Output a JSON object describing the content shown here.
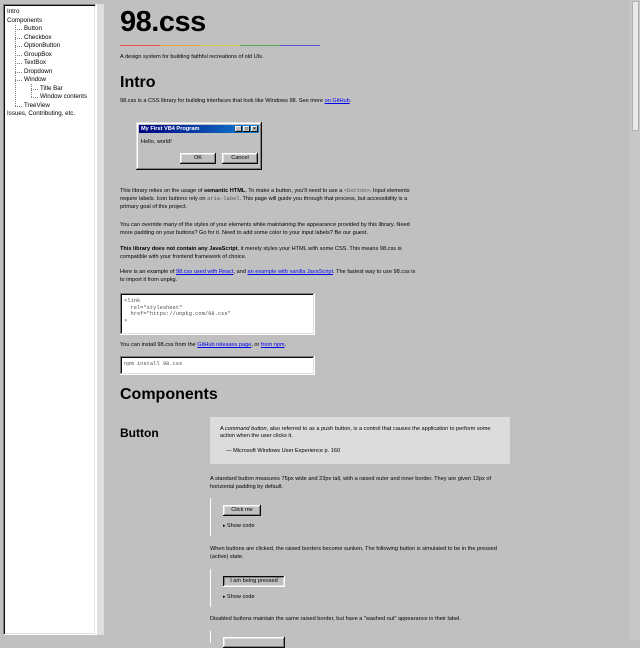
{
  "sidebar": {
    "items": [
      {
        "label": "Intro",
        "level": 0
      },
      {
        "label": "Components",
        "level": 0
      },
      {
        "label": "Button",
        "level": 1
      },
      {
        "label": "Checkbox",
        "level": 1
      },
      {
        "label": "OptionButton",
        "level": 1
      },
      {
        "label": "GroupBox",
        "level": 1
      },
      {
        "label": "TextBox",
        "level": 1
      },
      {
        "label": "Dropdown",
        "level": 1
      },
      {
        "label": "Window",
        "level": 1
      },
      {
        "label": "Title Bar",
        "level": 2
      },
      {
        "label": "Window contents",
        "level": 2
      },
      {
        "label": "TreeView",
        "level": 1
      },
      {
        "label": "Issues, Contributing, etc.",
        "level": 0
      }
    ]
  },
  "header": {
    "title": "98.css",
    "tagline": "A design system for building faithful recreations of old UIs."
  },
  "intro": {
    "heading": "Intro",
    "p1_text": "98.css is a CSS library for building interfaces that look like Windows 98. See more ",
    "p1_link": "on GitHub",
    "p1_end": ".",
    "window": {
      "title": "My First VB4 Program",
      "body": "Hello, world!",
      "ok": "OK",
      "cancel": "Cancel",
      "min_icon": "_",
      "max_icon": "□",
      "close_icon": "×"
    },
    "p2_a": "This library relies on the usage of ",
    "p2_bold": "semantic HTML",
    "p2_b": ". To make a button, you'll need to use a ",
    "p2_code1": "<button>",
    "p2_c": ". Input elements require labels. Icon buttons rely on ",
    "p2_code2": "aria-label",
    "p2_d": ". This page will guide you through that process, but accessibility is a primary goal of this project.",
    "p3": "You can override many of the styles of your elements while maintaining the appearance provided by this library. Need more padding on your buttons? Go for it. Need to add some color to your input labels? Be our guest.",
    "p4_bold": "This library does not contain any JavaScript",
    "p4_rest": ", it merely styles your HTML with some CSS. This means 98.css is compatible with your frontend framework of choice.",
    "p5_a": "Here is an example of ",
    "p5_link1": "98.css used with React",
    "p5_b": ", and ",
    "p5_link2": "an example with vanilla JavaScript",
    "p5_c": ". The fastest way to use 98.css is to import it from unpkg.",
    "code1": "<link\n  rel=\"stylesheet\"\n  href=\"https://unpkg.com/98.css\"\n>",
    "p6_a": "You can install 98.css from the ",
    "p6_link1": "GitHub releases page",
    "p6_b": ", or ",
    "p6_link2": "from npm",
    "p6_c": ".",
    "code2": "npm install 98.css"
  },
  "components": {
    "heading": "Components",
    "button": {
      "heading": "Button",
      "quote_em": "command button",
      "quote_a": "A ",
      "quote_b": ", also referred to as a push button, is a control that causes the application to perform some action when the user clicks it.",
      "quote_cite": "— Microsoft Windows User Experience p. 160",
      "p1": "A standard button measures 75px wide and 23px tall, with a raised outer and inner border. They are given 12px of horizontal padding by default.",
      "click_me": "Click me",
      "show_code": "Show code",
      "p2": "When buttons are clicked, the raised borders become sunken. The following button is simulated to be in the pressed (active) state.",
      "pressed_label": "I am being pressed",
      "p3": "Disabled buttons maintain the same raised border, but have a \"washed out\" appearance in their label."
    }
  }
}
